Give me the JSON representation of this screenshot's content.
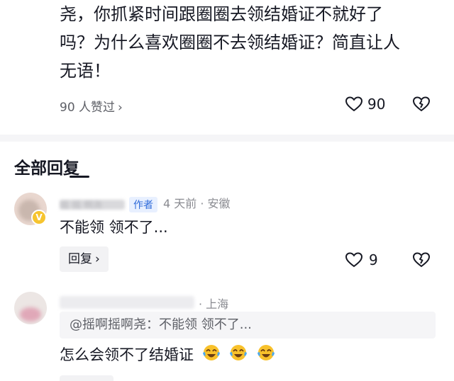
{
  "top_comment": {
    "lines": [
      "尧，你抓紧时间跟圈圈去领结婚证不就好了",
      "吗？为什么喜欢圈圈不去领结婚证？简直让人",
      "无语！"
    ],
    "liked_by": "90 人赞过",
    "like_count": "90"
  },
  "section": {
    "title": "全部回复"
  },
  "replies": [
    {
      "name_visible": "摇  摇 啊尧",
      "author_tag": "作者",
      "time_location": "4 天前 · 安徽",
      "text": "不能领 领不了...",
      "reply_label": "回复",
      "like_count": "9"
    },
    {
      "location": "· 上海",
      "quote": "@摇啊摇啊尧：不能领 领不了...",
      "text": "怎么会领不了结婚证",
      "emoji": [
        "crying-laughing-emoji",
        "crying-laughing-emoji",
        "crying-laughing-emoji"
      ]
    }
  ],
  "colors": {
    "accent_blue": "#2f6bd9",
    "text": "#161823",
    "muted": "#8a8b91",
    "verified": "#f6c42f"
  }
}
